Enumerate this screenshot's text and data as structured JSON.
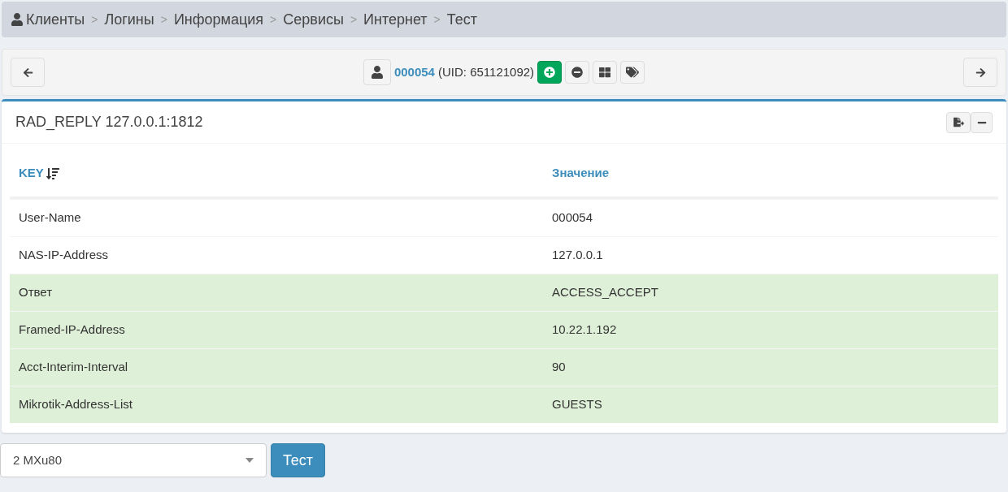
{
  "breadcrumb": [
    {
      "kind": "link",
      "label": "Клиенты"
    },
    {
      "kind": "separator",
      "label": ">"
    },
    {
      "kind": "link",
      "label": "Логины"
    },
    {
      "kind": "separator",
      "label": ">"
    },
    {
      "kind": "link",
      "label": "Информация"
    },
    {
      "kind": "separator",
      "label": ">"
    },
    {
      "kind": "link",
      "label": "Сервисы"
    },
    {
      "kind": "separator",
      "label": ">"
    },
    {
      "kind": "link",
      "label": "Интернет"
    },
    {
      "kind": "separator",
      "label": ">"
    },
    {
      "kind": "current",
      "label": "Тест"
    }
  ],
  "user": {
    "login": "000054",
    "uid": "(UID: 651121092)"
  },
  "panel": {
    "title": "RAD_REPLY 127.0.0.1:1812",
    "table": {
      "columns": [
        "KEY",
        "Значение"
      ],
      "rows": [
        {
          "key": "User-Name",
          "value": "000054",
          "highlighted": false
        },
        {
          "key": "NAS-IP-Address",
          "value": "127.0.0.1",
          "highlighted": false
        },
        {
          "key": "Ответ",
          "value": "ACCESS_ACCEPT",
          "highlighted": true
        },
        {
          "key": "Framed-IP-Address",
          "value": "10.22.1.192",
          "highlighted": true
        },
        {
          "key": "Acct-Interim-Interval",
          "value": "90",
          "highlighted": true
        },
        {
          "key": "Mikrotik-Address-List",
          "value": "GUESTS",
          "highlighted": true
        }
      ]
    }
  },
  "nas_select": {
    "value": "2 MXu80"
  },
  "test_button": "Тест"
}
